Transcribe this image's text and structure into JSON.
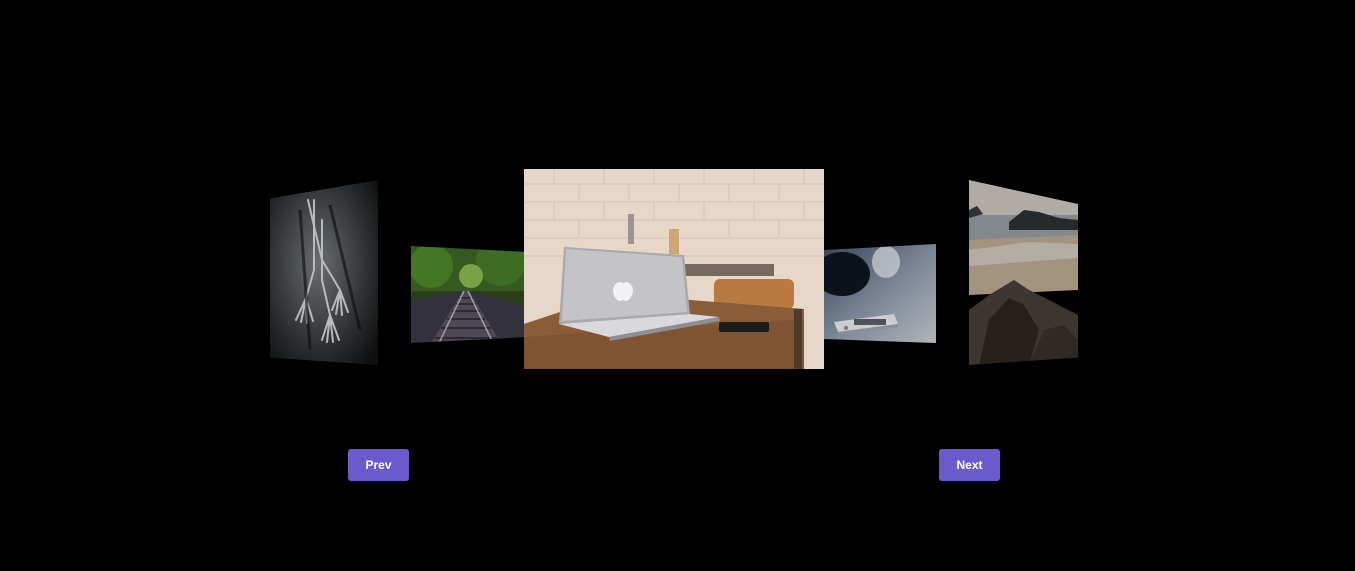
{
  "carousel": {
    "slides": [
      {
        "subject": "forks",
        "state": "side-far-left"
      },
      {
        "subject": "railway-tracks",
        "state": "side-near-left"
      },
      {
        "subject": "laptop-on-desk",
        "state": "active-center"
      },
      {
        "subject": "smartphone",
        "state": "side-near-right"
      },
      {
        "subject": "rocky-beach",
        "state": "side-far-right"
      }
    ]
  },
  "controls": {
    "prev_label": "Prev",
    "next_label": "Next",
    "button_color": "#6a5acd"
  }
}
